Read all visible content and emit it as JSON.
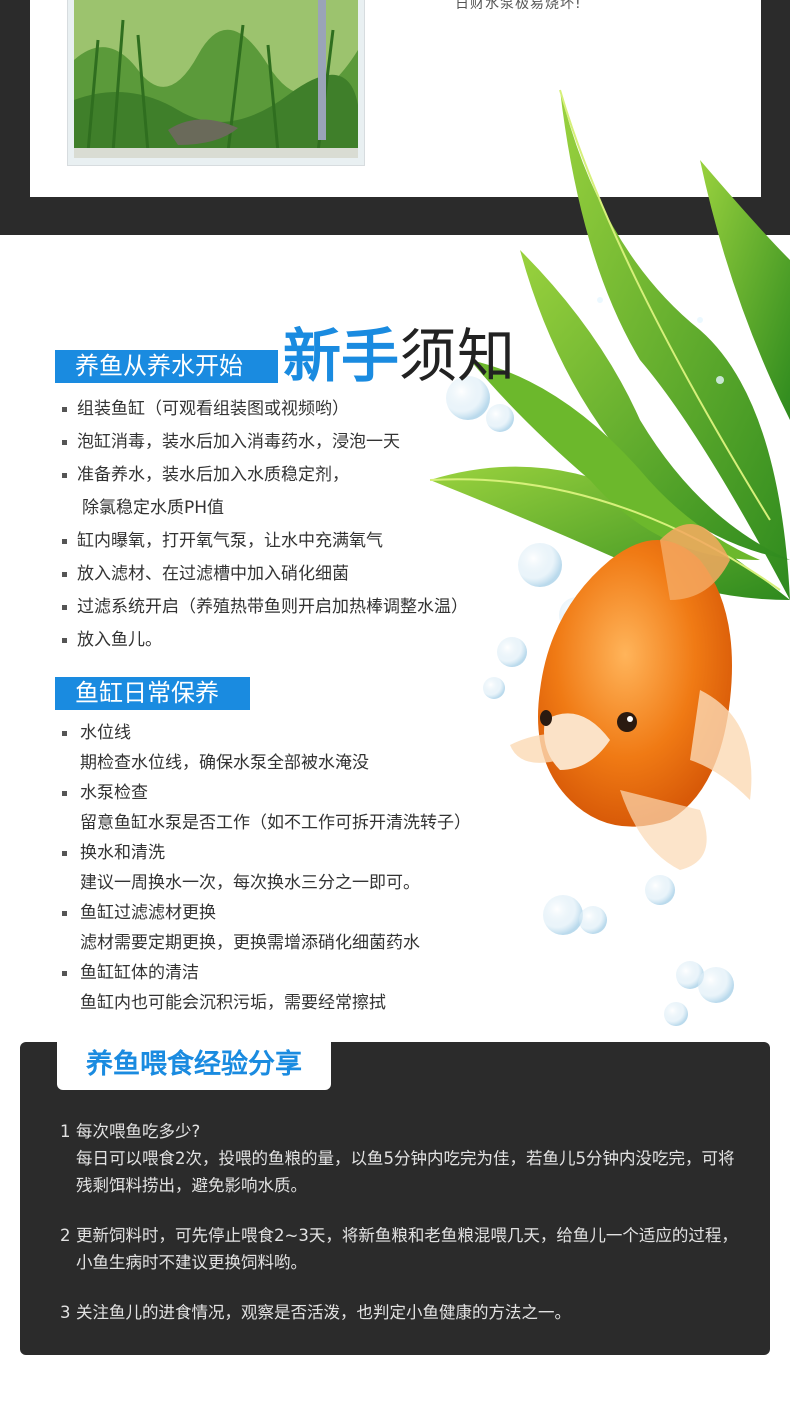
{
  "top": {
    "caption": "日财水泵极易烧坏!"
  },
  "intro": {
    "banner": "养鱼从养水开始",
    "title_bold": "新手",
    "title_rest": "须知",
    "steps": [
      "组装鱼缸（可观看组装图或视频哟）",
      "泡缸消毒，装水后加入消毒药水，浸泡一天",
      "准备养水，装水后加入水质稳定剂，",
      "除氯稳定水质PH值",
      "缸内曝氧，打开氧气泵，让水中充满氧气",
      "放入滤材、在过滤槽中加入硝化细菌",
      "过滤系统开启（养殖热带鱼则开启加热棒调整水温）",
      "放入鱼儿。"
    ]
  },
  "care": {
    "banner": "鱼缸日常保养",
    "items": [
      {
        "title": "水位线",
        "desc": "期检查水位线，确保水泵全部被水淹没"
      },
      {
        "title": "水泵检查",
        "desc": "留意鱼缸水泵是否工作（如不工作可拆开清洗转子）"
      },
      {
        "title": "换水和清洗",
        "desc": "建议一周换水一次，每次换水三分之一即可。"
      },
      {
        "title": "鱼缸过滤滤材更换",
        "desc": "滤材需要定期更换，更换需增添硝化细菌药水"
      },
      {
        "title": "鱼缸缸体的清洁",
        "desc": "鱼缸内也可能会沉积污垢，需要经常擦拭"
      }
    ]
  },
  "feeding": {
    "tab": "养鱼喂食经验分享",
    "items": [
      {
        "num": "1",
        "text": "每次喂鱼吃多少?",
        "detail": "每日可以喂食2次，投喂的鱼粮的量，以鱼5分钟内吃完为佳，若鱼儿5分钟内没吃完，可将残剩饵料捞出，避免影响水质。"
      },
      {
        "num": "2",
        "text": "更新饲料时，可先停止喂食2~3天，将新鱼粮和老鱼粮混喂几天，给鱼儿一个适应的过程，小鱼生病时不建议更换饲料哟。",
        "detail": ""
      },
      {
        "num": "3",
        "text": "关注鱼儿的进食情况，观察是否活泼，也判定小鱼健康的方法之一。",
        "detail": ""
      }
    ]
  },
  "colors": {
    "accent": "#1a8be0",
    "dark": "#2b2b2b"
  }
}
